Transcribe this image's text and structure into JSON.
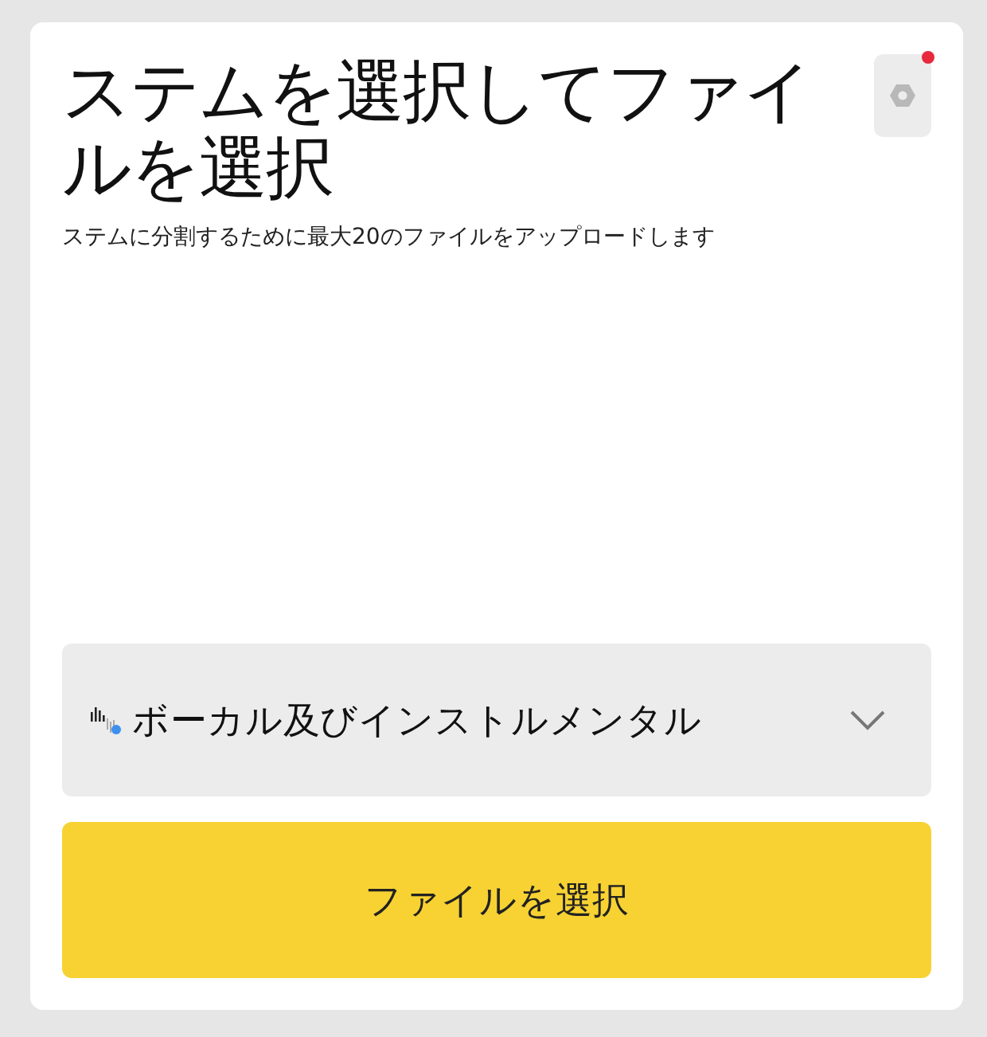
{
  "title": "ステムを選択してファイルを選択",
  "subtitle": "ステムに分割するために最大20のファイルをアップロードします",
  "settings": {
    "notification": true
  },
  "stem_select": {
    "value": "ボーカル及びインストルメンタル"
  },
  "buttons": [
    "ファイルを選択"
  ]
}
